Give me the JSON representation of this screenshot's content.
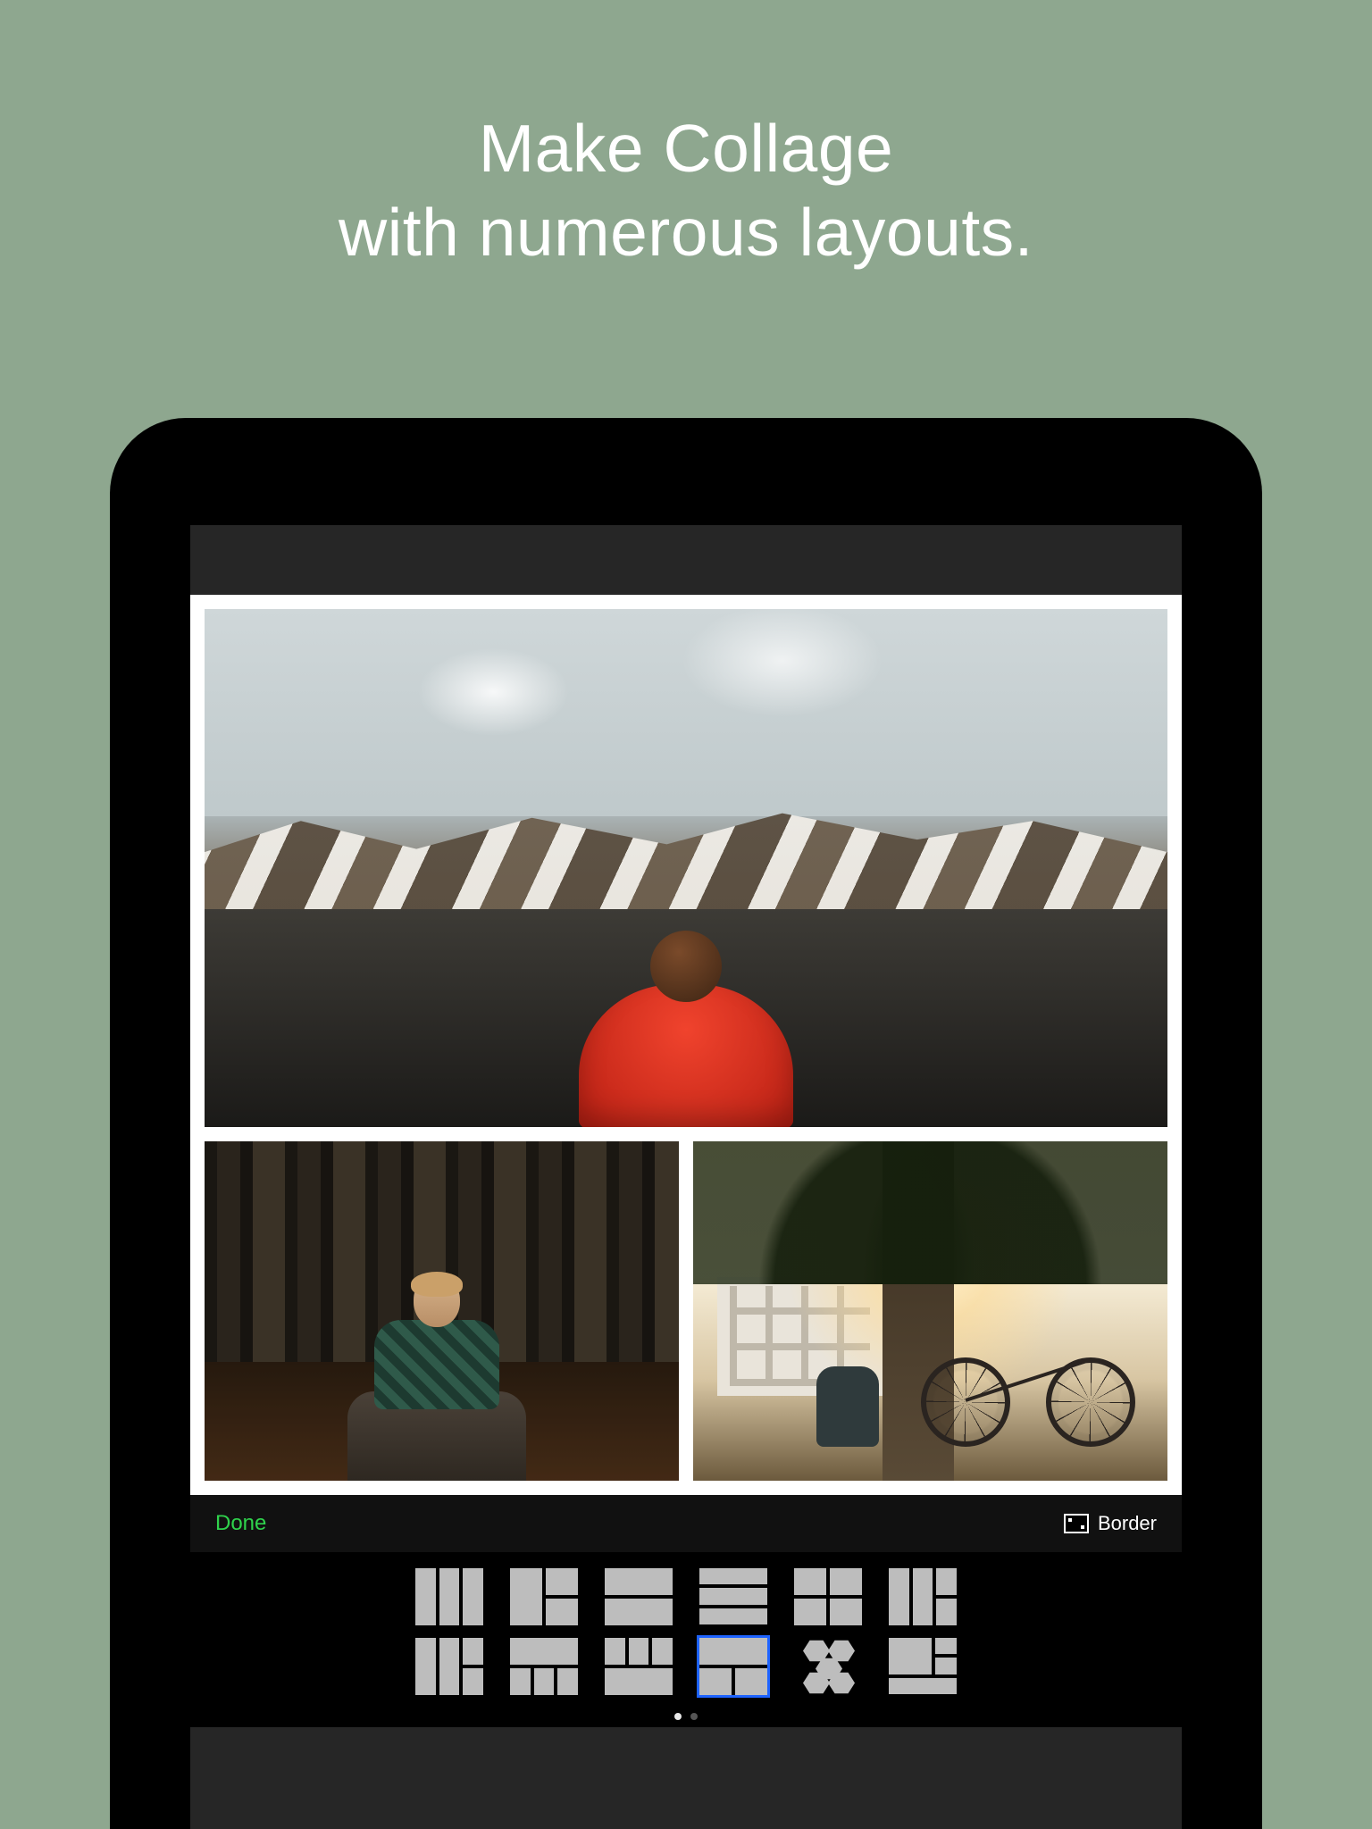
{
  "headline": {
    "line1": "Make Collage",
    "line2": "with numerous layouts."
  },
  "toolbar": {
    "done_label": "Done",
    "border_label": "Border"
  },
  "layout_names": {
    "r1c1": "three-columns",
    "r1c2": "col-2rows-right",
    "r1c3": "two-rows",
    "r1c4": "three-rows",
    "r1c5": "2x2-grid",
    "r1c6": "col-col-2rows",
    "r2c1": "2rows-col-col",
    "r2c2": "rows-3cols-bottom",
    "r2c3": "3cols-rows",
    "r2c4": "top-2x2-bottom",
    "r2c5": "hexagons",
    "r2c6": "big-side-2stack"
  },
  "selected_layout": "top-2x2-bottom",
  "page_indicator": {
    "total": 2,
    "active": 1
  }
}
